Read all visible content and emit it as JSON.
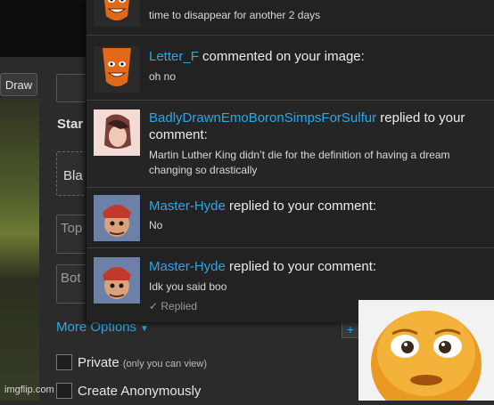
{
  "page": {
    "watermark": "imgflip.com"
  },
  "toolbar": {
    "draw_label": "Draw"
  },
  "form": {
    "start_label": "Star",
    "blank_text": "Bla",
    "top_text_placeholder": "Top",
    "bottom_text_placeholder": "Bot",
    "more_options_label": "More Options",
    "private_label": "Private",
    "private_note": "(only you can view)",
    "anon_label": "Create Anonymously",
    "add_symbol": "+"
  },
  "notifications": [
    {
      "user": "",
      "action": "",
      "body": "time to disappear for another 2 days",
      "meta": "",
      "avatar": "orange-face-avatar"
    },
    {
      "user": "Letter_F",
      "action": " commented on your image:",
      "body": "oh no",
      "meta": "",
      "avatar": "orange-face-avatar"
    },
    {
      "user": "BadlyDrawnEmoBoronSimpsForSulfur",
      "action": " replied to your comment:",
      "body": "Martin Luther King didn’t die for the definition of having a dream changing so drastically",
      "meta": "",
      "avatar": "emo-avatar"
    },
    {
      "user": "Master-Hyde",
      "action": " replied to your comment:",
      "body": "No",
      "meta": "",
      "avatar": "hyde-avatar"
    },
    {
      "user": "Master-Hyde",
      "action": " replied to your comment:",
      "body": "Idk you said boo",
      "meta": "✓ Replied",
      "avatar": "hyde-avatar"
    }
  ],
  "colors": {
    "link": "#2aa7e8",
    "panel_bg": "#222222",
    "page_bg": "#2b2b2b"
  }
}
